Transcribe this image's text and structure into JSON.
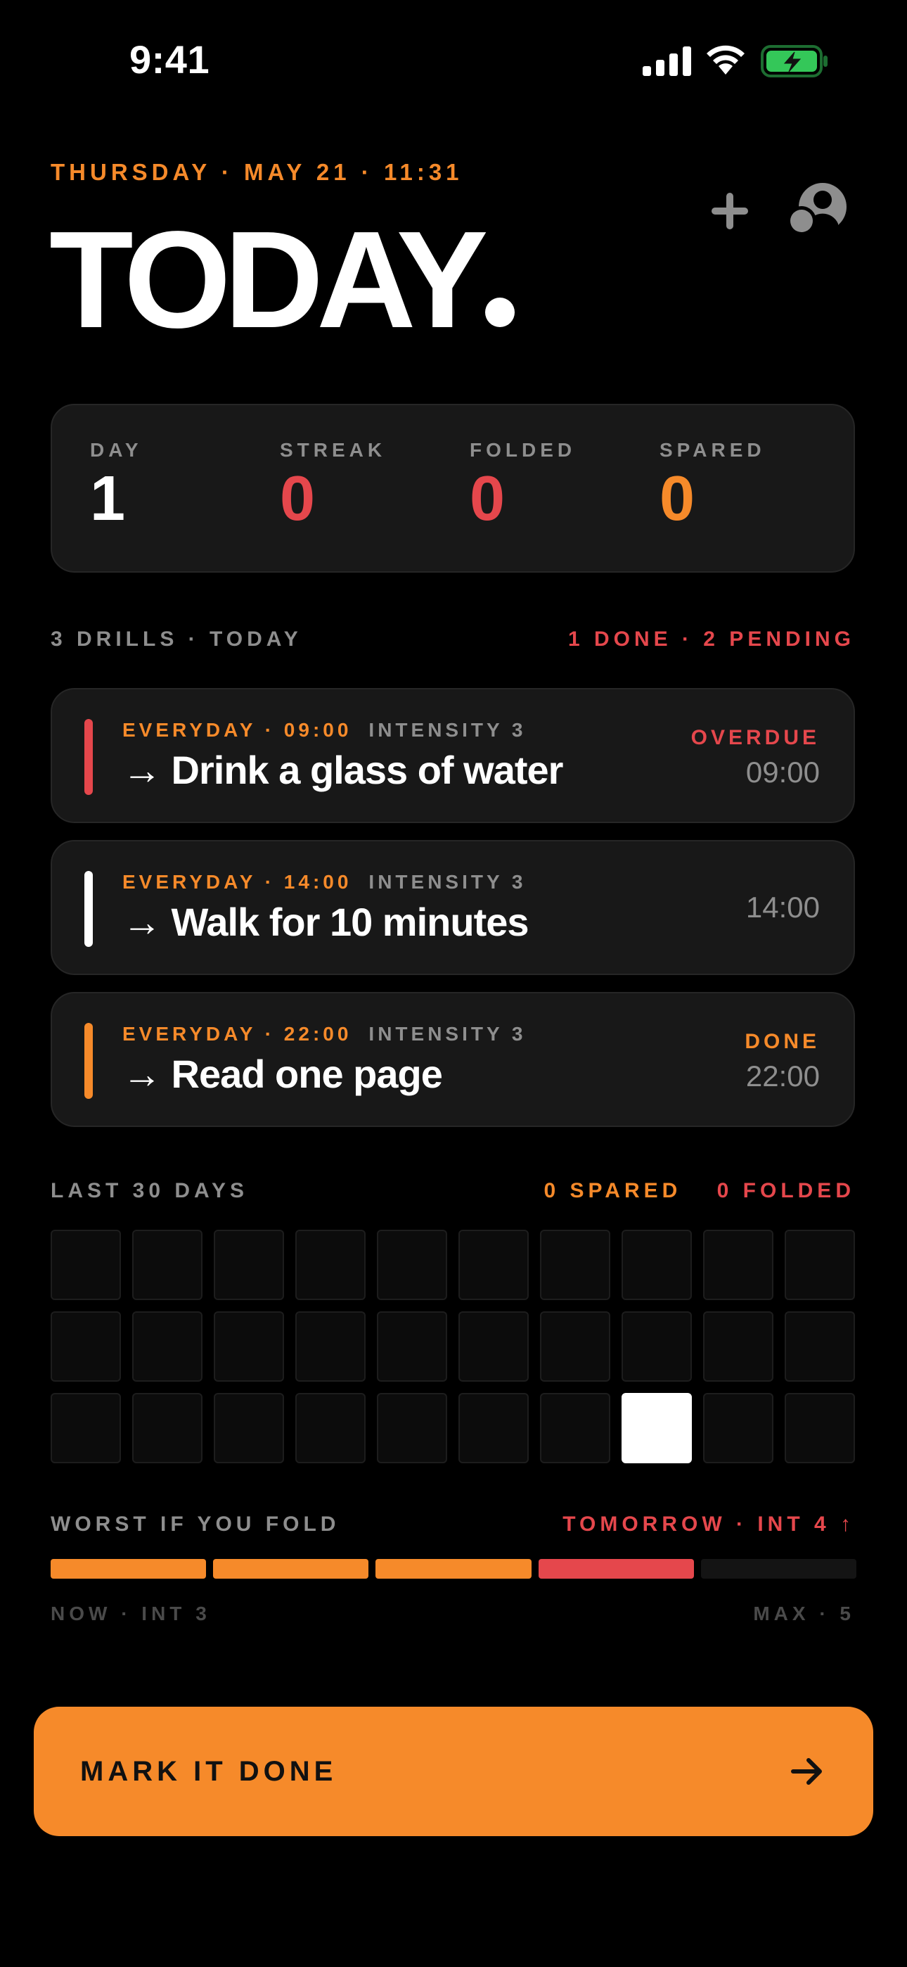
{
  "colors": {
    "accent": "#f68a2a",
    "danger": "#e5474c",
    "muted": "#8e8e8e",
    "card": "#181818",
    "battery": "#34c759"
  },
  "status_bar": {
    "time": "9:41",
    "icons": [
      "cellular-signal-icon",
      "wifi-icon",
      "battery-charging-icon"
    ]
  },
  "header": {
    "date_line": "THURSDAY · MAY 21 · 11:31",
    "title": "TODAY",
    "icons": [
      "plus-icon",
      "profile-icon"
    ]
  },
  "stats": [
    {
      "label": "DAY",
      "value": "1",
      "color": "#ffffff"
    },
    {
      "label": "STREAK",
      "value": "0",
      "color": "#e5474c"
    },
    {
      "label": "FOLDED",
      "value": "0",
      "color": "#e5474c"
    },
    {
      "label": "SPARED",
      "value": "0",
      "color": "#f68a2a"
    }
  ],
  "drills_section": {
    "left": "3 DRILLS · TODAY",
    "right": "1 DONE · 2 PENDING"
  },
  "drills": [
    {
      "schedule": "EVERYDAY · 09:00",
      "intensity": "INTENSITY 3",
      "title": "→ Drink a glass of water",
      "status": "OVERDUE",
      "time": "09:00",
      "bar_color": "#e5474c",
      "status_color": "#e5474c"
    },
    {
      "schedule": "EVERYDAY · 14:00",
      "intensity": "INTENSITY 3",
      "title": "→ Walk for 10 minutes",
      "status": "",
      "time": "14:00",
      "bar_color": "#ffffff",
      "status_color": "#8e8e8e"
    },
    {
      "schedule": "EVERYDAY · 22:00",
      "intensity": "INTENSITY 3",
      "title": "→ Read one page",
      "status": "DONE",
      "time": "22:00",
      "bar_color": "#f68a2a",
      "status_color": "#f68a2a"
    }
  ],
  "history": {
    "label": "LAST 30 DAYS",
    "spared": "0 SPARED",
    "folded": "0 FOLDED",
    "days": 30,
    "active_day_index": 27
  },
  "fold": {
    "label": "WORST IF YOU FOLD",
    "right": "TOMORROW · INT 4 ↑",
    "now": "NOW · INT 3",
    "max": "MAX · 5",
    "segments": [
      "#f68a2a",
      "#f68a2a",
      "#f68a2a",
      "#e5474c",
      "#141414"
    ]
  },
  "cta": {
    "label": "MARK IT DONE",
    "icon": "arrow-right-icon"
  }
}
